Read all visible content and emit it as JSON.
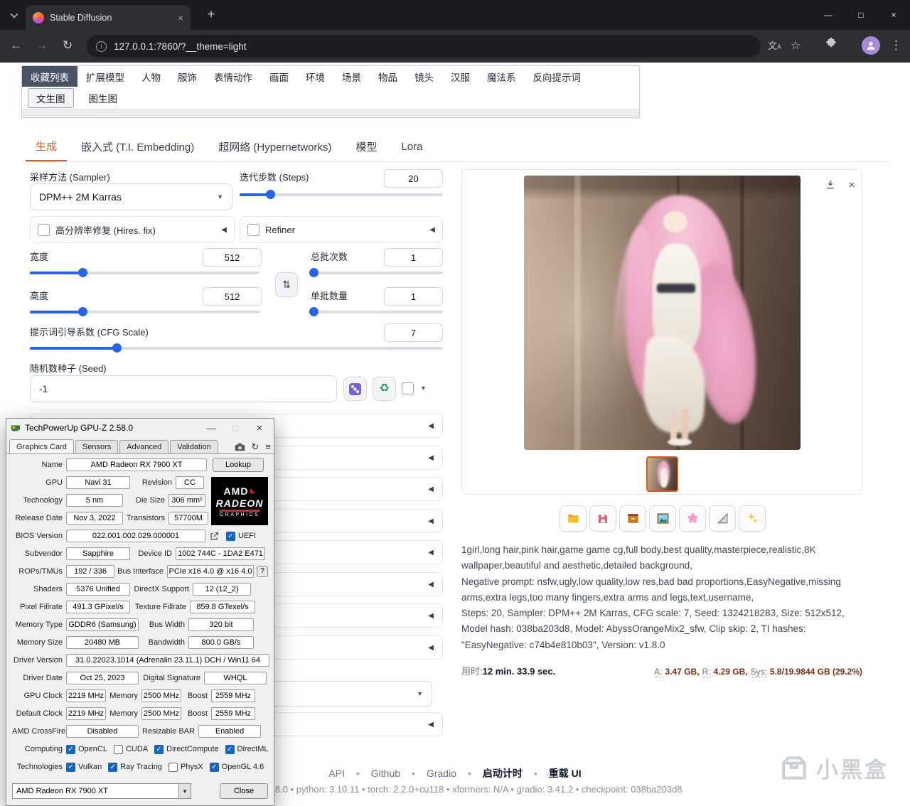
{
  "colors": {
    "accent_orange": "#ea580c",
    "slider_blue": "#2563eb",
    "selected_category_tab_bg": "#4a5366",
    "thumbnail_border": "#e8590c",
    "amd_red": "#e2231a"
  },
  "browser": {
    "tab_title": "Stable Diffusion",
    "url": "127.0.0.1:7860/?__theme=light",
    "min_glyph": "—",
    "max_glyph": "□",
    "close_glyph": "×",
    "newtab_glyph": "+"
  },
  "category_tabs": [
    "收藏列表",
    "扩展模型",
    "人物",
    "服饰",
    "表情动作",
    "画面",
    "环境",
    "场景",
    "物品",
    "镜头",
    "汉服",
    "魔法系",
    "反向提示词"
  ],
  "mode_tabs": [
    "文生图",
    "图生图"
  ],
  "main_tabs": [
    "生成",
    "嵌入式 (T.I. Embedding)",
    "超网络 (Hypernetworks)",
    "模型",
    "Lora"
  ],
  "generation": {
    "sampler_label": "采样方法 (Sampler)",
    "sampler_value": "DPM++ 2M Karras",
    "steps_label": "迭代步数 (Steps)",
    "steps_value": "20",
    "hires_label": "高分辨率修复 (Hires. fix)",
    "refiner_label": "Refiner",
    "width_label": "宽度",
    "width_value": "512",
    "height_label": "高度",
    "height_value": "512",
    "batch_count_label": "总批次数",
    "batch_count_value": "1",
    "batch_size_label": "单批数量",
    "batch_size_value": "1",
    "cfg_label": "提示词引导系数 (CFG Scale)",
    "cfg_value": "7",
    "seed_label": "随机数种子 (Seed)",
    "seed_value": "-1"
  },
  "output": {
    "info_prompt": "1girl,long hair,pink hair,game game cg,full body,best quality,masterpiece,realistic,8K wallpaper,beautiful and aesthetic,detailed background,",
    "info_negative": "Negative prompt: nsfw,ugly,low quality,low res,bad bad proportions,EasyNegative,missing arms,extra legs,too many fingers,extra arms and legs,text,username,",
    "info_params": "Steps: 20, Sampler: DPM++ 2M Karras, CFG scale: 7, Seed: 1324218283, Size: 512x512, Model hash: 038ba203d8, Model: AbyssOrangeMix2_sfw, Clip skip: 2, TI hashes: \"EasyNegative: c74b4e810b03\", Version: v1.8.0",
    "time_label": "用时:",
    "time_value": "12 min. 33.9 sec.",
    "mem": {
      "a_label": "A:",
      "a_value": "3.47 GB,",
      "r_label": "R:",
      "r_value": "4.29 GB,",
      "sys_label": "Sys:",
      "sys_value": "5.8/19.9844 GB (29.2%)"
    }
  },
  "footer": {
    "links": [
      "API",
      "Github",
      "Gradio",
      "启动计时",
      "重载 UI"
    ],
    "separator": "•",
    "version_line": "version: v1.8.0  •  python: 3.10.11  •  torch: 2.2.0+cu118  •  xformers: N/A  •  gradio: 3.41.2  •  checkpoint: 038ba203d8"
  },
  "watermark": "小黑盒",
  "gpuz": {
    "title": "TechPowerUp GPU-Z 2.58.0",
    "tabs": [
      "Graphics Card",
      "Sensors",
      "Advanced",
      "Validation"
    ],
    "name_label": "Name",
    "name": "AMD Radeon RX 7900 XT",
    "lookup": "Lookup",
    "gpu_label": "GPU",
    "gpu": "Navi 31",
    "revision_label": "Revision",
    "revision": "CC",
    "technology_label": "Technology",
    "technology": "5 nm",
    "die_size_label": "Die Size",
    "die_size": "306 mm²",
    "release_date_label": "Release Date",
    "release_date": "Nov 3, 2022",
    "transistors_label": "Transistors",
    "transistors": "57700M",
    "bios_label": "BIOS Version",
    "bios": "022.001.002.029.000001",
    "uefi_label": "UEFI",
    "subvendor_label": "Subvendor",
    "subvendor": "Sapphire",
    "device_id_label": "Device ID",
    "device_id": "1002 744C - 1DA2 E471",
    "rops_label": "ROPs/TMUs",
    "rops": "192 / 336",
    "bus_label": "Bus Interface",
    "bus": "PCIe x16 4.0 @ x16 4.0",
    "help": "?",
    "shaders_label": "Shaders",
    "shaders": "5376 Unified",
    "directx_label": "DirectX Support",
    "directx": "12 (12_2)",
    "pixel_label": "Pixel Fillrate",
    "pixel": "491.3 GPixel/s",
    "texture_label": "Texture Fillrate",
    "texture": "859.8 GTexel/s",
    "memtype_label": "Memory Type",
    "memtype": "GDDR6 (Samsung)",
    "buswidth_label": "Bus Width",
    "buswidth": "320 bit",
    "memsize_label": "Memory Size",
    "memsize": "20480 MB",
    "bandwidth_label": "Bandwidth",
    "bandwidth": "800.0 GB/s",
    "driver_label": "Driver Version",
    "driver": "31.0.22023.1014 (Adrenalin 23.11.1) DCH / Win11 64",
    "driverdate_label": "Driver Date",
    "driverdate": "Oct 25, 2023",
    "sig_label": "Digital Signature",
    "sig": "WHQL",
    "gpuclock_label": "GPU Clock",
    "gpuclock": "2219 MHz",
    "memclock_label": "Memory",
    "memclock": "2500 MHz",
    "boost_label": "Boost",
    "boost": "2559 MHz",
    "defclock_label": "Default Clock",
    "defclock": "2219 MHz",
    "defmem_label": "Memory",
    "defmem": "2500 MHz",
    "defboost_label": "Boost",
    "defboost": "2559 MHz",
    "crossfire_label": "AMD CrossFire",
    "crossfire": "Disabled",
    "rebar_label": "Resizable BAR",
    "rebar": "Enabled",
    "computing_label": "Computing",
    "computing": [
      {
        "label": "OpenCL",
        "checked": true
      },
      {
        "label": "CUDA",
        "checked": false
      },
      {
        "label": "DirectCompute",
        "checked": true
      },
      {
        "label": "DirectML",
        "checked": true
      }
    ],
    "technologies_label": "Technologies",
    "technologies": [
      {
        "label": "Vulkan",
        "checked": true
      },
      {
        "label": "Ray Tracing",
        "checked": true
      },
      {
        "label": "PhysX",
        "checked": false
      },
      {
        "label": "OpenGL 4.6",
        "checked": true
      }
    ],
    "logo": {
      "amd": "AMD",
      "radeon": "RADEON",
      "graphics": "GRAPHICS"
    },
    "select_value": "AMD Radeon RX 7900 XT",
    "close": "Close"
  }
}
